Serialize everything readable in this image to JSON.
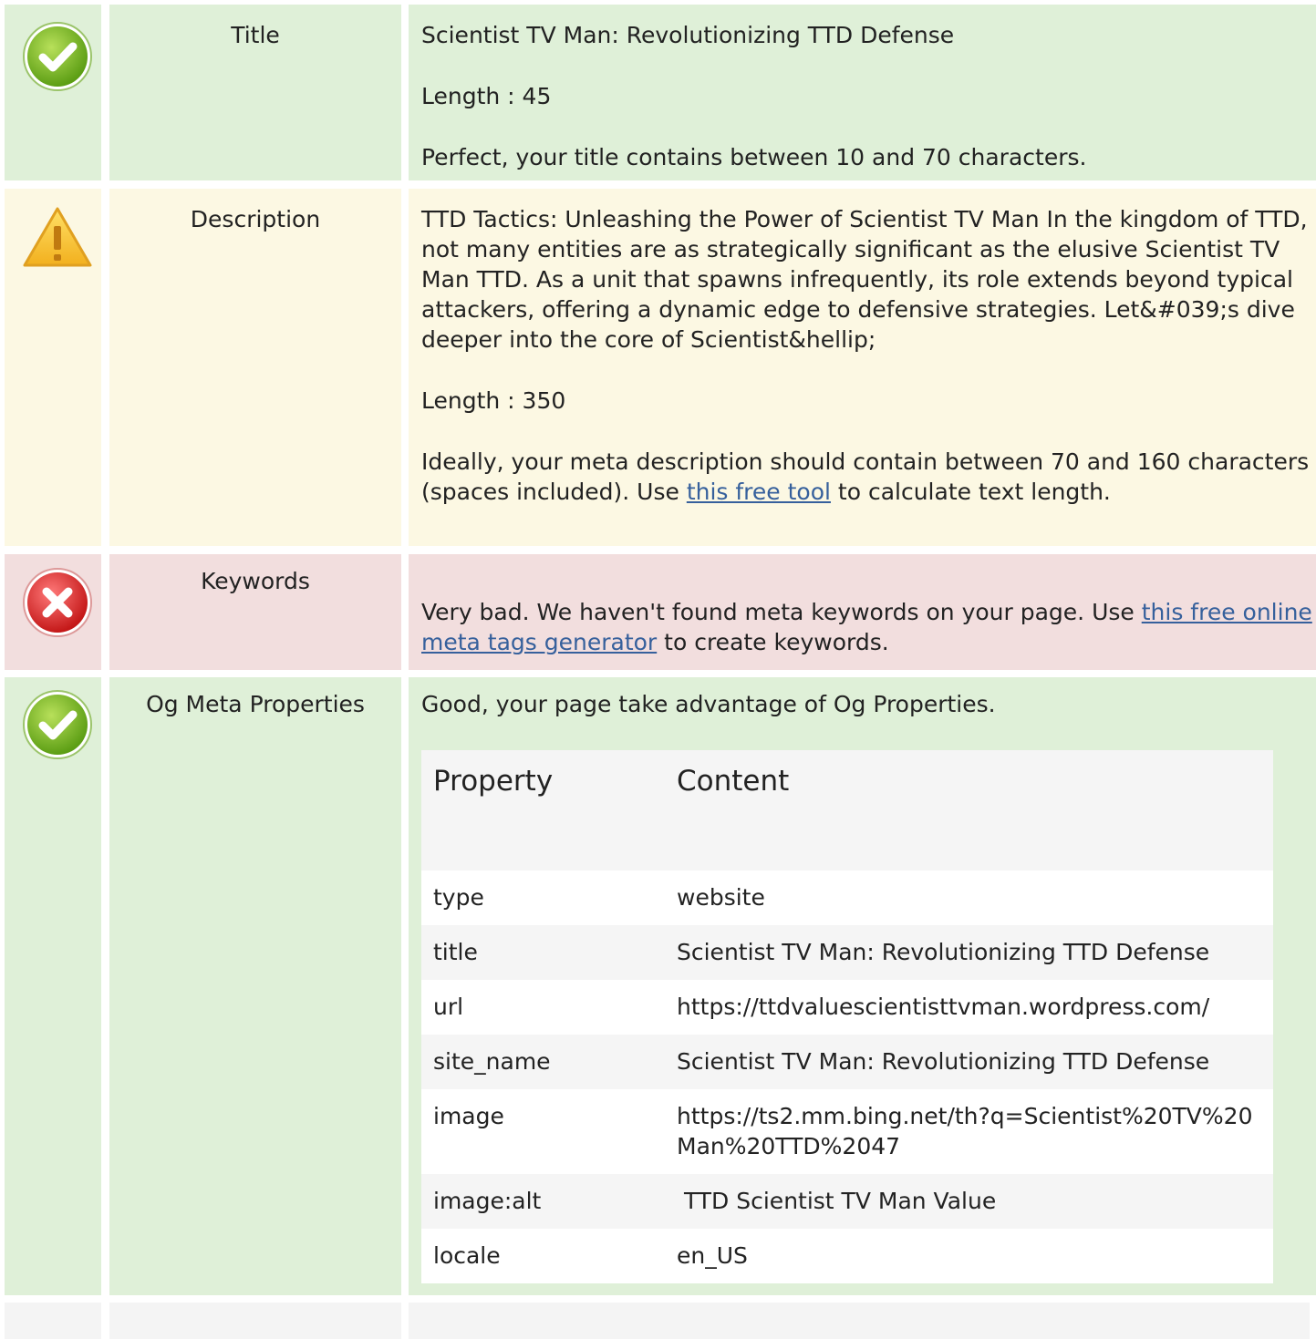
{
  "rows": {
    "title": {
      "label": "Title",
      "status": "good",
      "value": "Scientist TV Man: Revolutionizing TTD Defense",
      "length_text": "Length : 45",
      "advice": "Perfect, your title contains between 10 and 70 characters."
    },
    "description": {
      "label": "Description",
      "status": "warning",
      "value": "TTD Tactics: Unleashing the Power of Scientist TV Man In the kingdom of TTD, not many entities are as strategically significant as the elusive Scientist TV Man TTD. As a unit that spawns infrequently, its role extends beyond typical attackers, offering a dynamic edge to defensive strategies. Let&#039;s dive deeper into the core of Scientist&hellip;",
      "length_text": "Length : 350",
      "advice_before": "Ideally, your meta description should contain between 70 and 160 characters (spaces included). Use ",
      "advice_link": "this free tool",
      "advice_after": " to calculate text length."
    },
    "keywords": {
      "label": "Keywords",
      "status": "bad",
      "advice_before": "Very bad. We haven't found meta keywords on your page. Use ",
      "advice_link": "this free online meta tags generator",
      "advice_after": " to create keywords."
    },
    "og": {
      "label": "Og Meta Properties",
      "status": "good",
      "summary": "Good, your page take advantage of Og Properties.",
      "table_headers": {
        "property": "Property",
        "content": "Content"
      },
      "properties": [
        {
          "property": "type",
          "content": "website"
        },
        {
          "property": "title",
          "content": "Scientist TV Man: Revolutionizing TTD Defense"
        },
        {
          "property": "url",
          "content": "https://ttdvaluescientisttvman.wordpress.com/"
        },
        {
          "property": "site_name",
          "content": "Scientist TV Man: Revolutionizing TTD Defense"
        },
        {
          "property": "image",
          "content": "https://ts2.mm.bing.net/th?q=Scientist%20TV%20Man%20TTD%2047"
        },
        {
          "property": "image:alt",
          "content": " TTD Scientist TV Man Value"
        },
        {
          "property": "locale",
          "content": "en_US"
        }
      ]
    }
  },
  "colors": {
    "good_bg": "#dff0d8",
    "warning_bg": "#fcf8e3",
    "bad_bg": "#f2dede",
    "link": "#36609c"
  },
  "icons": {
    "good": "check-circle-icon",
    "warning": "warning-triangle-icon",
    "bad": "error-x-circle-icon"
  }
}
